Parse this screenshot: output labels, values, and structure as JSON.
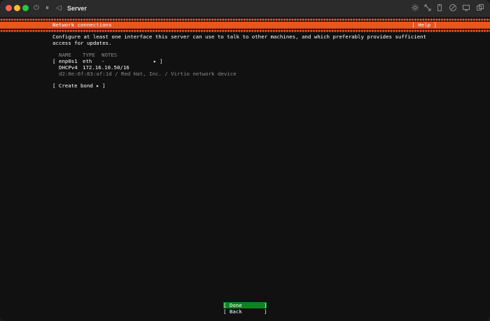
{
  "window": {
    "title": "Server"
  },
  "header": {
    "title": "Network connections",
    "help_label": "[ Help ]"
  },
  "intro": {
    "line1": "Configure at least one interface this server can use to talk to other machines, and which preferably provides sufficient",
    "line2": "access for updates."
  },
  "table": {
    "headers": {
      "name": "NAME",
      "type": "TYPE",
      "notes": "NOTES"
    },
    "interfaces": [
      {
        "open_bracket": "[",
        "name": "enp0s1",
        "type": "eth",
        "notes": "-",
        "arrow": "▸ ]",
        "mode": "DHCPv4",
        "address": "172.16.10.50/16",
        "details": "d2:0e:6f:83:af:1d / Red Hat, Inc. / Virtio network device"
      }
    ]
  },
  "create_bond_label": "[ Create bond ▸ ]",
  "buttons": {
    "done": "[ Done       ]",
    "back": "[ Back       ]"
  },
  "colors": {
    "accent": "#e95420",
    "done_button": "#0e8420",
    "background": "#111111",
    "dim_text": "#8c8c8c"
  }
}
